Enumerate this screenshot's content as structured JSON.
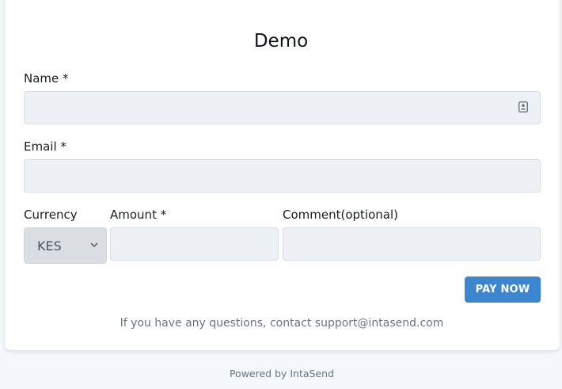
{
  "form": {
    "title": "Demo",
    "name_label": "Name *",
    "name_value": "",
    "email_label": "Email *",
    "email_value": "",
    "currency_label": "Currency",
    "currency_selected": "KES",
    "amount_label": "Amount *",
    "amount_value": "",
    "comment_label": "Comment(optional)",
    "comment_value": "",
    "pay_button": "PAY NOW",
    "contact_text": "If you have any questions, contact support@intasend.com"
  },
  "footer": {
    "powered_by": "Powered by IntaSend"
  },
  "colors": {
    "accent": "#3b86cf",
    "field_bg": "#edf1f6",
    "page_bg": "#f4f7fb"
  },
  "icons": {
    "name_field": "contact-card-icon",
    "currency_select": "chevron-down-icon"
  }
}
